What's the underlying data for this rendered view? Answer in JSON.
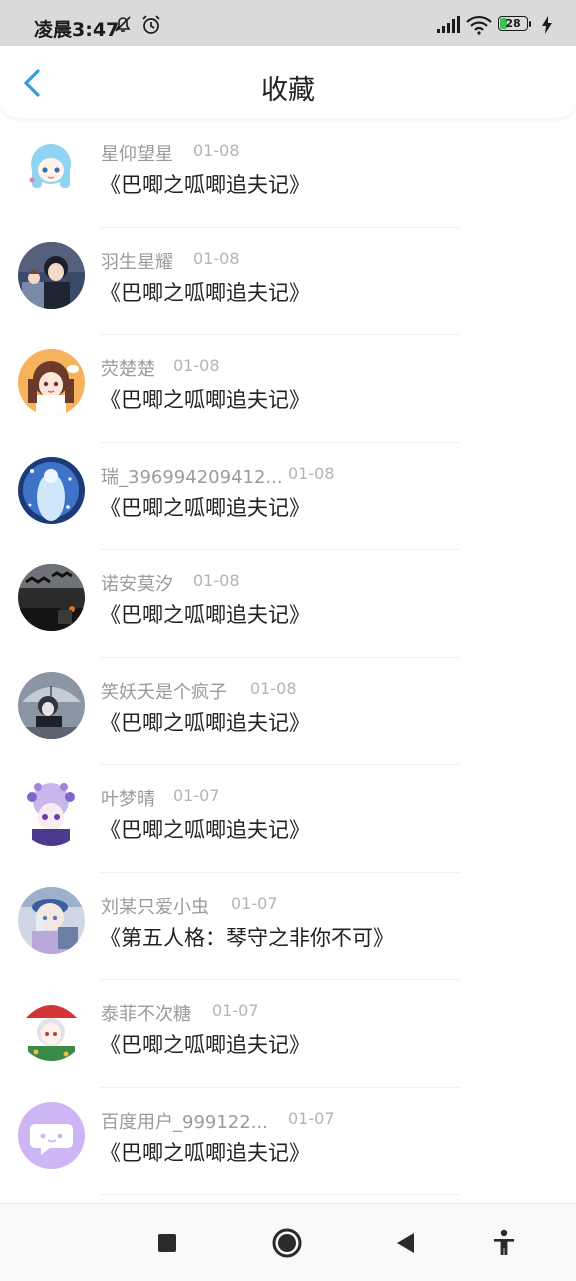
{
  "status_bar": {
    "time": "凌晨3:47",
    "battery": "28",
    "battery_fill": 0.28
  },
  "header": {
    "title": "收藏",
    "back_icon": "chevron-left-icon",
    "accent_color": "#2f9fe0"
  },
  "favorites": [
    {
      "user": "星仰望星",
      "date": "01-08",
      "book": "《巴唧之呱唧追夫记》",
      "avatar": "anime-blue-girl"
    },
    {
      "user": "羽生星耀",
      "date": "01-08",
      "book": "《巴唧之呱唧追夫记》",
      "avatar": "anime-boy-dark"
    },
    {
      "user": "荧楚楚",
      "date": "01-08",
      "book": "《巴唧之呱唧追夫记》",
      "avatar": "anime-girl-orange"
    },
    {
      "user": "瑞_396994209412...",
      "date": "01-08",
      "book": "《巴唧之呱唧追夫记》",
      "avatar": "anime-blue-dress"
    },
    {
      "user": "诺安莫汐",
      "date": "01-08",
      "book": "《巴唧之呱唧追夫记》",
      "avatar": "dark-bats"
    },
    {
      "user": "笑妖夭是个疯子",
      "date": "01-08",
      "book": "《巴唧之呱唧追夫记》",
      "avatar": "anime-gray-umbrella"
    },
    {
      "user": "叶梦晴",
      "date": "01-07",
      "book": "《巴唧之呱唧追夫记》",
      "avatar": "anime-purple-flowers"
    },
    {
      "user": "刘某只爱小虫",
      "date": "01-07",
      "book": "《第五人格：琴守之非你不可》",
      "avatar": "anime-blue-hat"
    },
    {
      "user": "泰菲不次糖",
      "date": "01-07",
      "book": "《巴唧之呱唧追夫记》",
      "avatar": "anime-christmas"
    },
    {
      "user": "百度用户_999122...",
      "date": "01-07",
      "book": "《巴唧之呱唧追夫记》",
      "avatar": "default-chat-avatar"
    }
  ],
  "nav_bar": {
    "recent_icon": "square-icon",
    "home_icon": "circle-icon",
    "back_icon": "triangle-back-icon",
    "accessibility_icon": "accessibility-icon"
  }
}
